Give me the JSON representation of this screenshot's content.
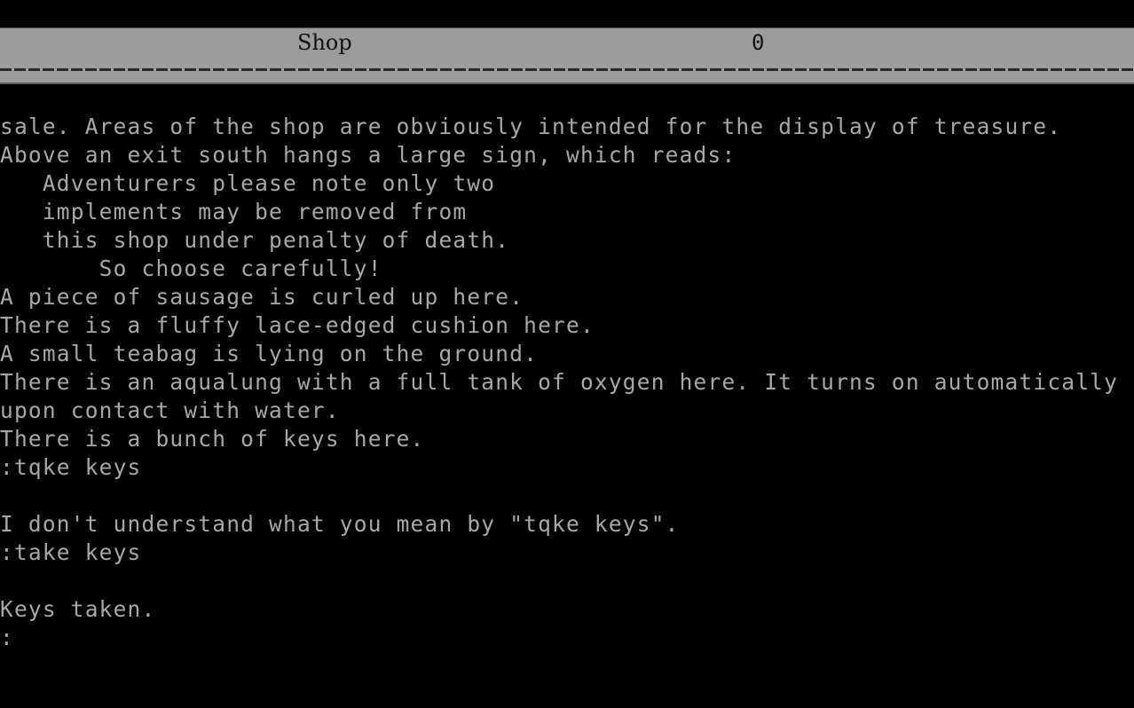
{
  "status_bar": {
    "location": "Shop",
    "score": "0"
  },
  "transcript": {
    "lines": [
      "sale. Areas of the shop are obviously intended for the display of treasure.",
      "Above an exit south hangs a large sign, which reads:",
      "   Adventurers please note only two",
      "   implements may be removed from",
      "   this shop under penalty of death.",
      "       So choose carefully!",
      "A piece of sausage is curled up here.",
      "There is a fluffy lace-edged cushion here.",
      "A small teabag is lying on the ground.",
      "There is an aqualung with a full tank of oxygen here. It turns on automatically",
      "upon contact with water.",
      "There is a bunch of keys here.",
      ":tqke keys",
      "",
      "I don't understand what you mean by \"tqke keys\".",
      ":take keys",
      "",
      "Keys taken.",
      ":"
    ]
  },
  "colors": {
    "background": "#000000",
    "text": "#a8a8a8",
    "status_bar_bg": "#9c9c9c",
    "status_bar_text": "#111111"
  }
}
